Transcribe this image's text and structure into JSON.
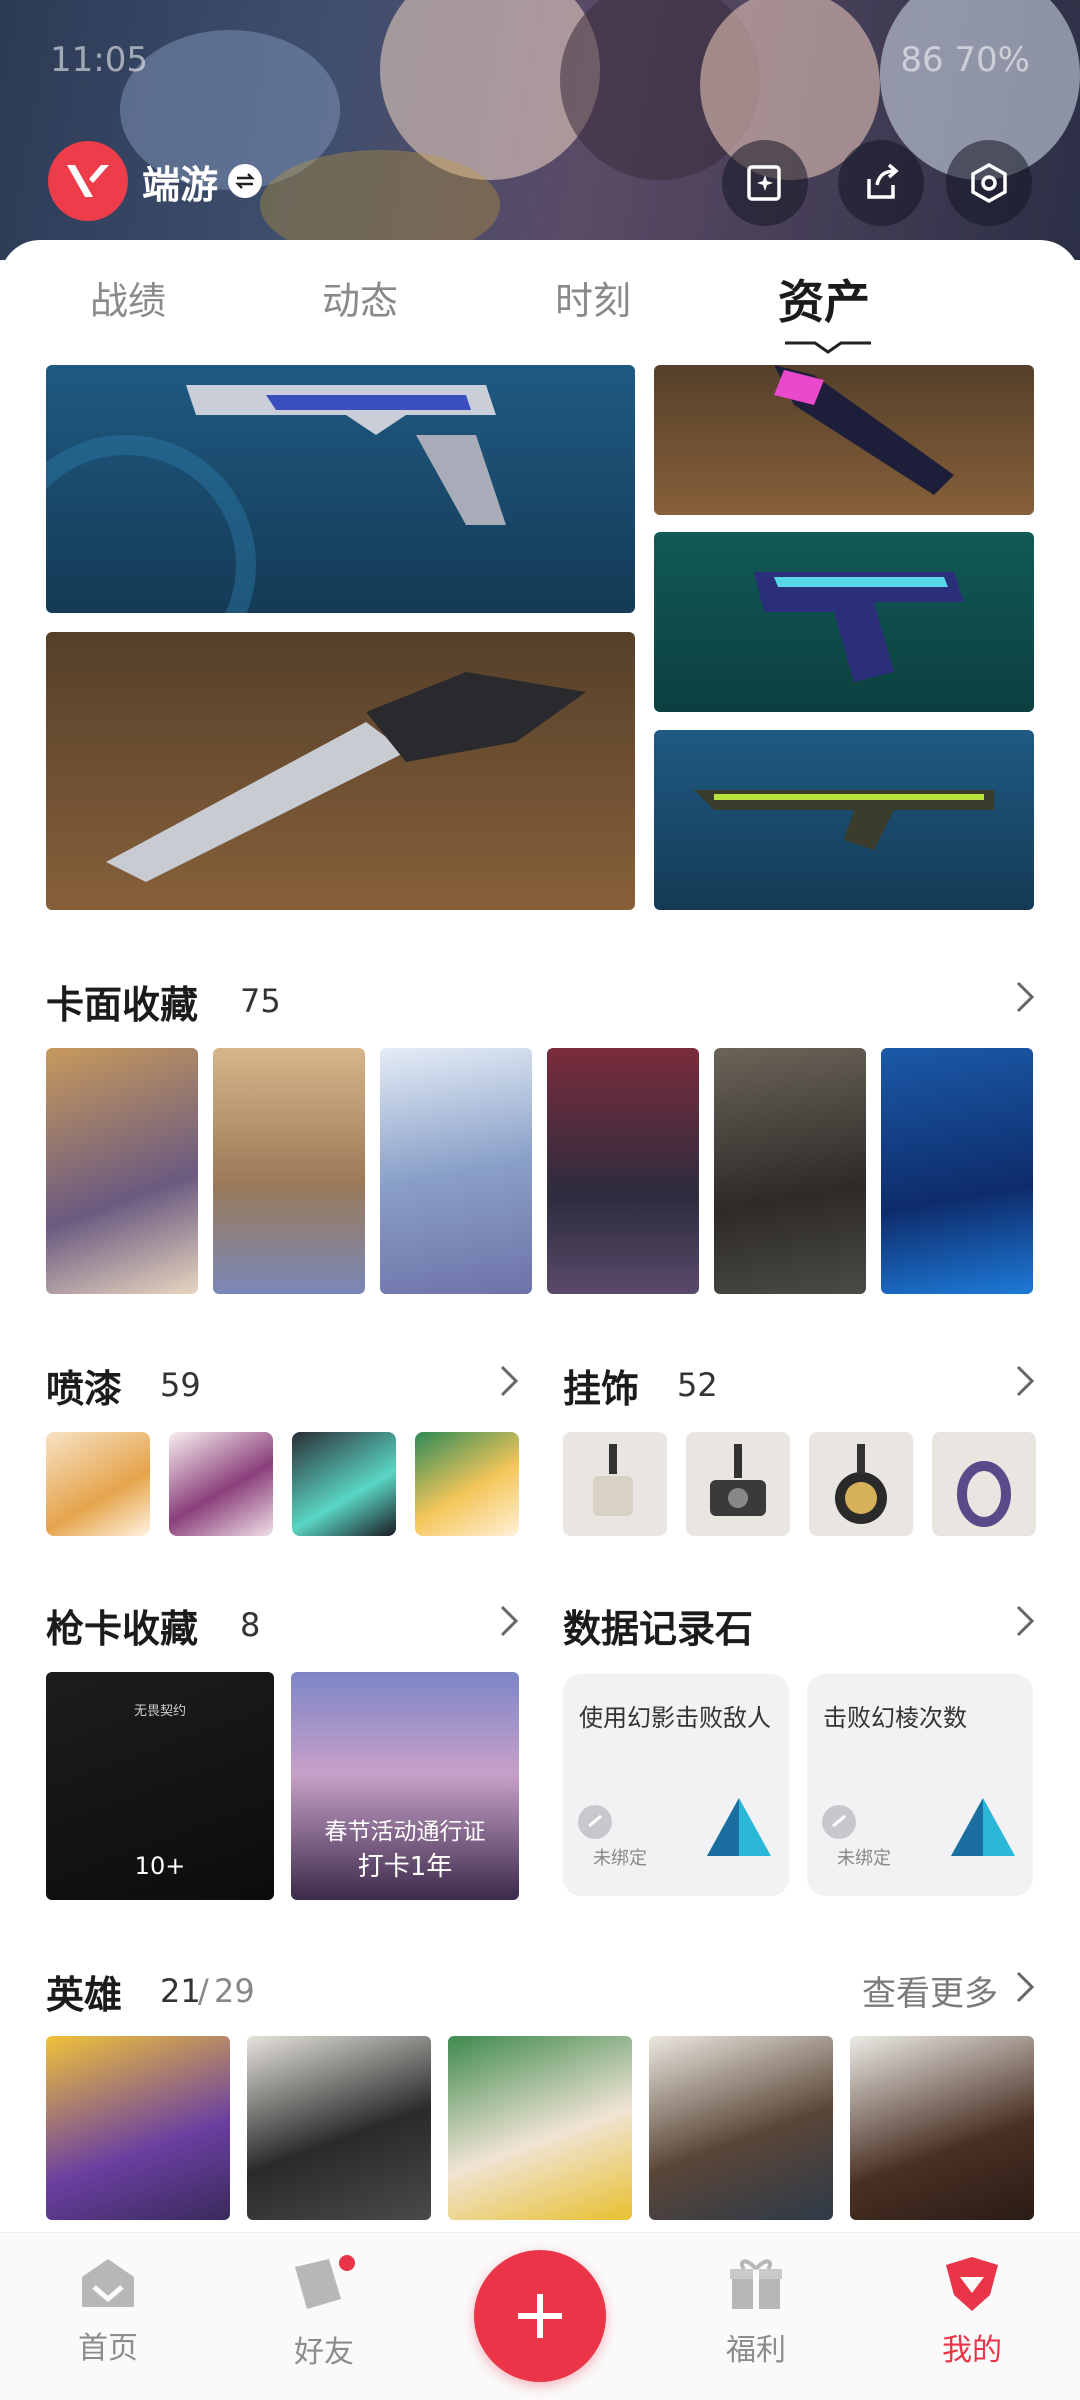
{
  "status_bar": {
    "time": "11:05",
    "right": "86 70%"
  },
  "brand": {
    "name": "端游"
  },
  "tabs": [
    {
      "label": "战绩"
    },
    {
      "label": "动态"
    },
    {
      "label": "时刻"
    },
    {
      "label": "资产"
    }
  ],
  "sections": {
    "cards": {
      "title": "卡面收藏",
      "count": "75"
    },
    "sprays": {
      "title": "喷漆",
      "count": "59"
    },
    "charms": {
      "title": "挂饰",
      "count": "52"
    },
    "gun_cards": {
      "title": "枪卡收藏",
      "count": "8",
      "items": [
        {
          "top_label": "无畏契约",
          "badge": "10+"
        },
        {
          "caption_line1": "春节活动通行证",
          "caption_line2": "打卡1年"
        }
      ]
    },
    "records": {
      "title": "数据记录石",
      "items": [
        {
          "label": "使用幻影击败敌人",
          "status": "未绑定"
        },
        {
          "label": "击败幻棱次数",
          "status": "未绑定"
        }
      ]
    },
    "heroes": {
      "title": "英雄",
      "owned": "21",
      "sep": "/",
      "total": "29",
      "more": "查看更多"
    }
  },
  "nav": [
    {
      "label": "首页"
    },
    {
      "label": "好友"
    },
    {
      "label": "福利"
    },
    {
      "label": "我的"
    }
  ],
  "colors": {
    "accent": "#ea3448",
    "tile_blue": "#1f5a82",
    "tile_brown": "#87603a",
    "tile_teal": "#115a57"
  }
}
